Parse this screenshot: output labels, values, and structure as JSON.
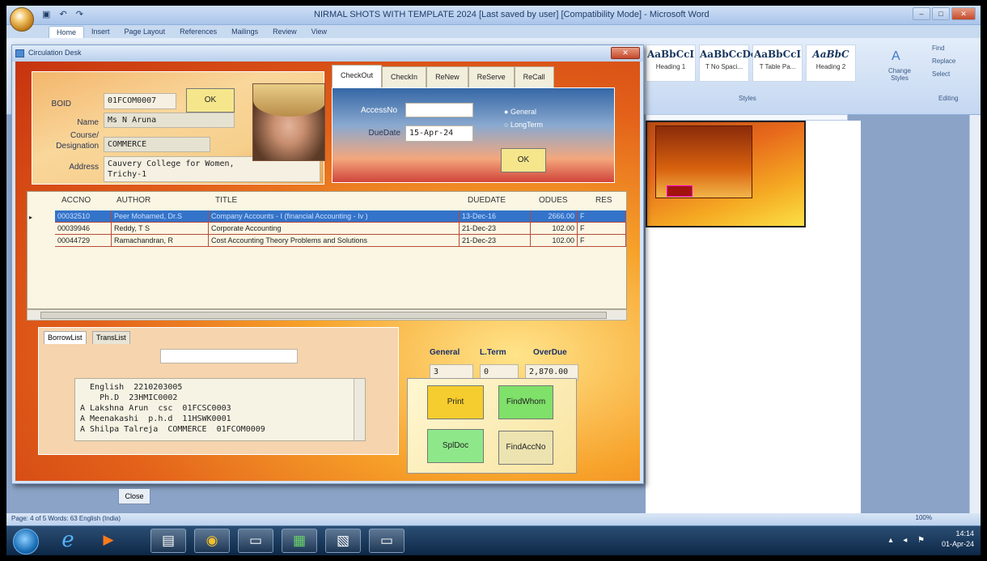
{
  "word": {
    "title": "NIRMAL SHOTS WITH TEMPLATE 2024 [Last saved by user] [Compatibility Mode] - Microsoft Word",
    "tabs": [
      "Home",
      "Insert",
      "Page Layout",
      "References",
      "Mailings",
      "Review",
      "View"
    ],
    "styles": [
      {
        "sample": "AaBbCcI",
        "name": "Heading 1"
      },
      {
        "sample": "AaBbCcDc",
        "name": "T No Spaci..."
      },
      {
        "sample": "AaBbCcI",
        "name": "T Table Pa..."
      },
      {
        "sample": "AaBbC",
        "name": "Heading 2"
      }
    ],
    "change_styles": "Change Styles",
    "find": "Find",
    "replace": "Replace",
    "select": "Select",
    "styles_group": "Styles",
    "editing_group": "Editing",
    "status": "Page: 4 of 5   Words: 63   English (India)",
    "zoom": "100%"
  },
  "taskbar": {
    "time": "14:14",
    "date": "01-Apr-24"
  },
  "circulation": {
    "title": "Circulation Desk",
    "close_label": "Close",
    "borrower": {
      "boid_label": "BOID",
      "boid": "01FCOM0007",
      "ok_label": "OK",
      "name_label": "Name",
      "name": "Ms N Aruna",
      "course_label": "Course/ Designation",
      "course": "COMMERCE",
      "address_label": "Address",
      "address": "Cauvery College for Women,\nTrichy-1"
    },
    "tabs": [
      "CheckOut",
      "CheckIn",
      "ReNew",
      "ReServe",
      "ReCall"
    ],
    "checkout": {
      "access_label": "AccessNo",
      "access_value": "",
      "due_label": "DueDate",
      "due_value": "15-Apr-24",
      "opt_general": "General",
      "opt_longterm": "LongTerm",
      "ok_label": "OK"
    },
    "grid": {
      "columns": [
        "ACCNO",
        "AUTHOR",
        "TITLE",
        "DUEDATE",
        "ODUES",
        "RES"
      ],
      "rows": [
        [
          "00032510",
          "Peer Mohamed, Dr.S",
          "Company Accounts - I (financial Accounting - Iv )",
          "13-Dec-16",
          "2666.00",
          "F"
        ],
        [
          "00039946",
          "Reddy, T S",
          "Corporate Accounting",
          "21-Dec-23",
          "102.00",
          "F"
        ],
        [
          "00044729",
          "Ramachandran, R",
          "Cost Accounting Theory Problems and Solutions",
          "21-Dec-23",
          "102.00",
          "F"
        ]
      ]
    },
    "lists": {
      "tabs": [
        "BorrowList",
        "TransList"
      ],
      "search_value": "",
      "items": "  English  2210203005\n    Ph.D  23HMIC0002\nA Lakshna Arun  csc  01FCSC0003\nA Meenakashi  p.h.d  11HSWK0001\nA Shilpa Talreja  COMMERCE  01FCOM0009"
    },
    "stats": {
      "general_label": "General",
      "lterm_label": "L.Term",
      "overdue_label": "OverDue",
      "general": "3",
      "lterm": "0",
      "overdue": "2,870.00"
    },
    "actions": {
      "print": "Print",
      "findwhom": "FindWhom",
      "spldoc": "SplDoc",
      "findaccno": "FindAccNo"
    }
  }
}
